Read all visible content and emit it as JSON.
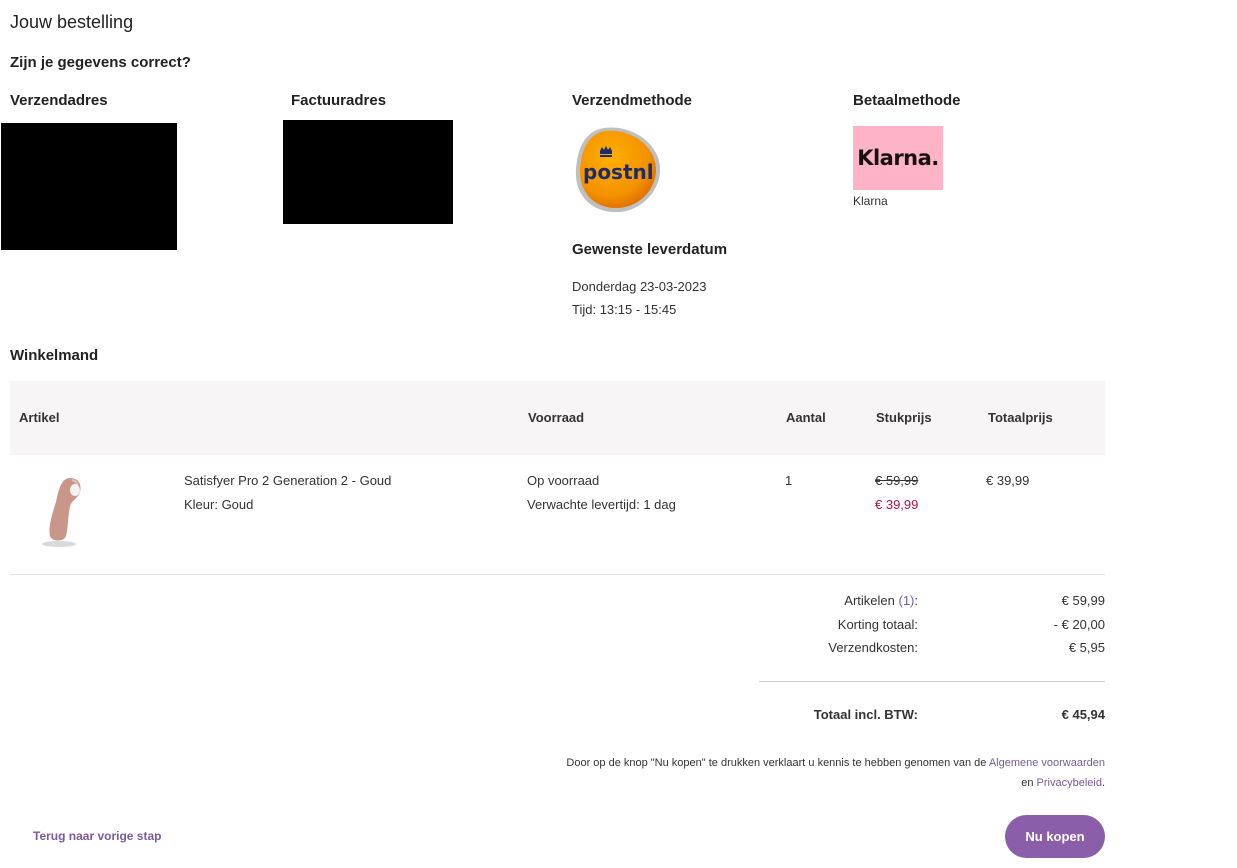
{
  "page": {
    "title": "Jouw bestelling",
    "subtitle": "Zijn je gegevens correct?"
  },
  "shipping_address": {
    "heading": "Verzendadres"
  },
  "billing_address": {
    "heading": "Factuuradres"
  },
  "shipping_method": {
    "heading": "Verzendmethode",
    "logo_text": "postnl",
    "logo_color": "#f39200"
  },
  "payment_method": {
    "heading": "Betaalmethode",
    "logo_text": "Klarna.",
    "logo_bg": "#ffb3c7",
    "name": "Klarna"
  },
  "delivery": {
    "heading": "Gewenste leverdatum",
    "date": "Donderdag 23-03-2023",
    "time": "Tijd: 13:15 - 15:45"
  },
  "cart": {
    "heading": "Winkelmand",
    "columns": [
      "Artikel",
      "Voorraad",
      "Aantal",
      "Stukprijs",
      "Totaalprijs"
    ],
    "items": [
      {
        "name": "Satisfyer Pro 2 Generation 2 - Goud",
        "variant": "Kleur: Goud",
        "stock": "Op voorraad",
        "lead_time": "Verwachte levertijd: 1 dag",
        "quantity": "1",
        "old_price": "€ 59,99",
        "price": "€ 39,99",
        "total": "€ 39,99"
      }
    ]
  },
  "summary": {
    "articles_label": "Artikelen",
    "articles_count": "(1)",
    "articles_colon": ":",
    "articles_value": "€ 59,99",
    "discount_label": "Korting totaal:",
    "discount_value": "- € 20,00",
    "shipping_label": "Verzendkosten:",
    "shipping_value": "€ 5,95",
    "total_label": "Totaal incl. BTW:",
    "total_value": "€ 45,94"
  },
  "legal": {
    "text_1": "Door op de knop \"Nu kopen\" te drukken verklaart u kennis te hebben genomen van de ",
    "terms_link": "Algemene voorwaarden",
    "text_2": "en ",
    "privacy_link": "Privacybeleid",
    "text_3": "."
  },
  "actions": {
    "back_label": "Terug naar vorige stap",
    "buy_label": "Nu kopen"
  },
  "colors": {
    "accent": "#8a5ea8",
    "sale": "#b0124f",
    "table_header_bg": "#f7f5f5"
  }
}
